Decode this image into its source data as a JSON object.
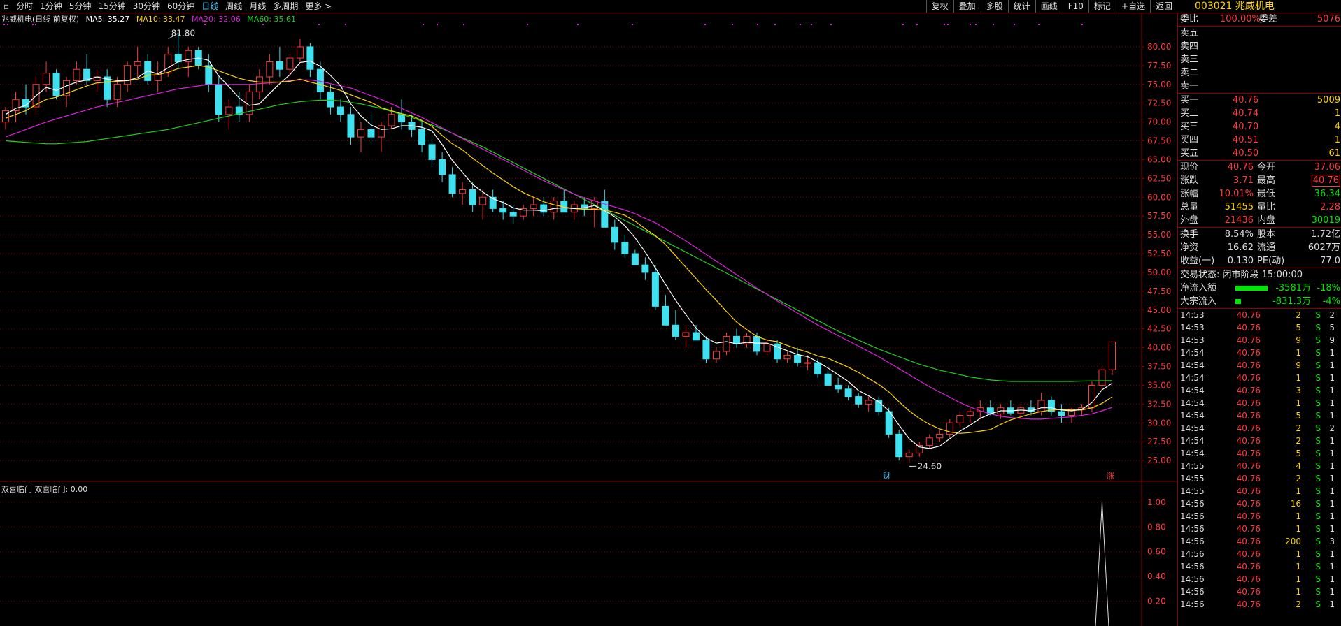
{
  "toolbar": {
    "tabs": [
      "分时",
      "1分钟",
      "5分钟",
      "15分钟",
      "30分钟",
      "60分钟",
      "日线",
      "周线",
      "月线",
      "多周期",
      "更多 >"
    ],
    "active_tab": "日线",
    "right_buttons": [
      "复权",
      "叠加",
      "多股",
      "统计",
      "画线",
      "F10",
      "标记",
      "+自选",
      "返回"
    ]
  },
  "stock": {
    "code": "003021",
    "name": "兆威机电"
  },
  "legend": {
    "title": "兆威机电(日线 前复权)",
    "ma5": "MA5: 35.27",
    "ma10": "MA10: 33.47",
    "ma20": "MA20: 32.06",
    "ma60": "MA60: 35.61"
  },
  "colors": {
    "up": "#ff3b3b",
    "down": "#3fe0f0",
    "ma5": "#ffffff",
    "ma10": "#ffd400",
    "ma20": "#e020e0",
    "ma60": "#20d020",
    "grid": "#8b0000"
  },
  "markers": {
    "high": "81.80",
    "low": "24.60",
    "cai": "财",
    "zhang": "涨"
  },
  "sub_legend": "双喜临门 双喜临门: 0.00",
  "chart_data": {
    "type": "candlestick",
    "y_ticks": [
      "80.00",
      "77.50",
      "75.00",
      "72.50",
      "70.00",
      "67.50",
      "65.00",
      "62.50",
      "60.00",
      "57.50",
      "55.00",
      "52.50",
      "50.00",
      "47.50",
      "45.00",
      "42.50",
      "40.00",
      "37.50",
      "35.00",
      "32.50",
      "30.00",
      "27.50",
      "25.00"
    ],
    "ylim": [
      22.5,
      82.5
    ],
    "candles": [
      [
        70,
        72,
        69,
        71.5
      ],
      [
        71.5,
        74,
        70,
        73
      ],
      [
        73,
        75,
        71,
        72
      ],
      [
        72,
        76,
        71,
        75
      ],
      [
        75,
        78,
        74,
        76.5
      ],
      [
        76.5,
        77,
        73,
        73.5
      ],
      [
        73.5,
        76,
        72,
        75.5
      ],
      [
        75.5,
        78,
        75,
        77
      ],
      [
        77,
        79,
        75,
        75.5
      ],
      [
        75.5,
        77,
        74,
        76
      ],
      [
        76,
        77,
        72,
        73
      ],
      [
        73,
        76,
        72,
        75
      ],
      [
        75,
        78,
        74,
        77.5
      ],
      [
        77.5,
        80,
        76,
        78
      ],
      [
        78,
        79,
        75,
        75.5
      ],
      [
        75.5,
        78,
        74,
        76.5
      ],
      [
        76.5,
        80,
        76,
        79
      ],
      [
        79,
        81.8,
        77,
        78
      ],
      [
        78,
        80,
        76,
        79.5
      ],
      [
        79.5,
        80,
        77,
        77.5
      ],
      [
        77.5,
        79,
        74,
        75
      ],
      [
        75,
        76,
        70,
        71
      ],
      [
        71,
        73,
        69,
        72
      ],
      [
        72,
        74,
        70,
        71
      ],
      [
        71,
        75,
        70,
        74
      ],
      [
        74,
        77,
        73,
        76
      ],
      [
        76,
        79,
        75,
        78
      ],
      [
        78,
        80,
        76,
        77
      ],
      [
        77,
        79,
        76,
        78.5
      ],
      [
        78.5,
        81,
        78,
        80
      ],
      [
        80,
        80.5,
        76,
        77
      ],
      [
        77,
        78,
        73,
        74
      ],
      [
        74,
        75,
        71,
        72
      ],
      [
        72,
        73,
        70,
        71
      ],
      [
        71,
        72,
        67,
        68
      ],
      [
        68,
        70,
        66,
        69
      ],
      [
        69,
        71,
        67,
        68
      ],
      [
        68,
        70,
        66,
        69.5
      ],
      [
        69.5,
        72,
        69,
        71
      ],
      [
        71,
        73,
        69,
        70
      ],
      [
        70,
        71,
        68,
        69
      ],
      [
        69,
        70,
        66,
        67
      ],
      [
        67,
        68,
        64,
        65
      ],
      [
        65,
        66,
        62,
        63
      ],
      [
        63,
        64,
        60,
        60.5
      ],
      [
        60.5,
        62,
        59,
        61
      ],
      [
        61,
        62,
        58,
        59
      ],
      [
        59,
        61,
        57,
        60
      ],
      [
        60,
        61,
        58,
        58.5
      ],
      [
        58.5,
        59.5,
        57,
        58
      ],
      [
        58,
        59,
        56.5,
        57.5
      ],
      [
        57.5,
        59,
        57,
        58.5
      ],
      [
        58.5,
        60,
        57.5,
        59
      ],
      [
        59,
        60,
        57.5,
        58
      ],
      [
        58,
        60,
        57,
        59.5
      ],
      [
        59.5,
        61,
        58,
        58
      ],
      [
        58,
        59.5,
        57,
        59
      ],
      [
        59,
        60,
        57.5,
        58.5
      ],
      [
        58.5,
        60,
        56,
        59.5
      ],
      [
        59.5,
        61,
        57,
        56
      ],
      [
        56,
        57,
        53,
        54
      ],
      [
        54,
        55,
        52,
        52.5
      ],
      [
        52.5,
        53,
        51,
        51
      ],
      [
        51,
        52,
        49,
        50
      ],
      [
        50,
        51,
        45,
        45.5
      ],
      [
        45.5,
        47,
        43,
        43
      ],
      [
        43,
        45,
        41,
        41.5
      ],
      [
        41.5,
        43,
        40,
        42
      ],
      [
        42,
        43,
        41,
        41
      ],
      [
        41,
        41.5,
        38,
        38.5
      ],
      [
        38.5,
        40,
        38,
        39.5
      ],
      [
        39.5,
        42,
        39,
        41.5
      ],
      [
        41.5,
        42.5,
        40,
        40.5
      ],
      [
        40.5,
        42,
        40,
        41.5
      ],
      [
        41.5,
        42,
        39,
        39.5
      ],
      [
        39.5,
        41,
        39,
        40.5
      ],
      [
        40.5,
        41,
        38,
        38.5
      ],
      [
        38.5,
        39.5,
        38,
        39
      ],
      [
        39,
        40,
        37.5,
        38
      ],
      [
        38,
        39,
        37,
        38
      ],
      [
        38,
        38.5,
        36,
        36.5
      ],
      [
        36.5,
        37,
        35,
        35
      ],
      [
        35,
        36,
        34,
        34.5
      ],
      [
        34.5,
        35,
        33,
        33.5
      ],
      [
        33.5,
        34,
        32,
        32.5
      ],
      [
        32.5,
        33.5,
        31.5,
        33
      ],
      [
        33,
        33.5,
        31,
        31.5
      ],
      [
        31.5,
        32,
        28,
        28.5
      ],
      [
        28.5,
        29,
        25,
        25.5
      ],
      [
        25.5,
        26.5,
        24.6,
        26
      ],
      [
        26,
        27.5,
        25.5,
        27
      ],
      [
        27,
        28.5,
        26.5,
        28
      ],
      [
        28,
        29,
        27.5,
        28.5
      ],
      [
        28.5,
        30.5,
        28,
        30
      ],
      [
        30,
        31.5,
        29.5,
        31
      ],
      [
        31,
        32,
        30,
        31.5
      ],
      [
        31.5,
        33,
        30.5,
        32
      ],
      [
        32,
        33,
        31,
        31.2
      ],
      [
        31.2,
        32.5,
        30.5,
        32
      ],
      [
        32,
        33,
        31,
        31.3
      ],
      [
        31.3,
        32.5,
        30.5,
        32
      ],
      [
        32,
        33,
        31,
        31.5
      ],
      [
        31.5,
        34,
        31,
        33
      ],
      [
        33,
        33.5,
        31,
        31.5
      ],
      [
        31.5,
        32.5,
        30,
        31
      ],
      [
        31,
        32,
        30,
        31.8
      ],
      [
        31.8,
        32.5,
        31,
        32
      ],
      [
        32,
        35.5,
        31.5,
        35
      ],
      [
        35,
        37.5,
        34.5,
        37.06
      ],
      [
        37.06,
        40.76,
        36.34,
        40.76
      ]
    ],
    "ma5": [
      71,
      71.8,
      72.2,
      73.5,
      74.6,
      74.2,
      74.8,
      75.3,
      75.6,
      76,
      75.7,
      75.5,
      75.5,
      75.9,
      76.8,
      76.4,
      77.2,
      78,
      78.3,
      78.5,
      78.2,
      76.1,
      74.7,
      73.2,
      72.2,
      72.4,
      73.8,
      75.1,
      76.3,
      77.9,
      78.1,
      77.4,
      76.2,
      74.8,
      72.4,
      70.8,
      69.6,
      69,
      69.1,
      69.5,
      69.5,
      69.3,
      68.8,
      67,
      64.9,
      63.3,
      61.7,
      60.7,
      59.8,
      59.3,
      58.6,
      58.3,
      58.3,
      58.2,
      58.5,
      58.6,
      58.5,
      58.6,
      58.9,
      58.2,
      57.4,
      56.2,
      54.6,
      52.7,
      50.6,
      48.4,
      46.3,
      44.4,
      42.6,
      41.3,
      40.6,
      40.8,
      40.5,
      40.7,
      40.6,
      40.6,
      40.1,
      39.6,
      39.1,
      38.8,
      38.1,
      37.3,
      36.4,
      35.5,
      34.3,
      33.6,
      32.8,
      31.6,
      29.7,
      27.9,
      26.8,
      26.6,
      26.9,
      27.9,
      28.9,
      29.7,
      30.6,
      31.2,
      31.6,
      31.6,
      31.7,
      31.6,
      32,
      32,
      31.7,
      31.6,
      31.8,
      32.7,
      34.4,
      35.27
    ],
    "ma10": [
      70.5,
      71,
      71.5,
      72.3,
      73,
      73.3,
      73.8,
      74.3,
      74.8,
      75.2,
      75.3,
      75.4,
      75.5,
      75.7,
      76.2,
      76.3,
      76.6,
      77.1,
      77.3,
      77.5,
      77.3,
      76.8,
      76.3,
      75.8,
      75.5,
      75.3,
      75.3,
      75.3,
      75.4,
      75.7,
      75.3,
      75,
      74.6,
      74.2,
      73.6,
      73.1,
      72.6,
      71.9,
      71.5,
      71.1,
      70.8,
      70.2,
      69.4,
      68.2,
      67.1,
      66.3,
      65.2,
      64.2,
      63.2,
      62.3,
      61.4,
      60.6,
      60,
      59.4,
      59,
      58.7,
      58.5,
      58.4,
      58.4,
      58.3,
      58,
      57.6,
      56.8,
      55.8,
      54.9,
      53.7,
      52.2,
      50.7,
      49.2,
      47.7,
      46.3,
      44.8,
      43.4,
      42.4,
      41.5,
      41,
      40.8,
      40.3,
      39.8,
      39.4,
      38.9,
      38.6,
      38,
      37.4,
      36.7,
      35.9,
      35.1,
      34.1,
      32.8,
      31.6,
      30.6,
      29.8,
      29.2,
      28.8,
      28.6,
      28.7,
      28.9,
      29.1,
      29.8,
      30.4,
      30.8,
      31.2,
      31.5,
      31.7,
      31.8,
      31.7,
      31.7,
      32,
      32.6,
      33.47
    ],
    "ma20": [
      68,
      68.5,
      69,
      69.5,
      70,
      70.4,
      70.8,
      71.2,
      71.6,
      72,
      72.3,
      72.6,
      72.9,
      73.2,
      73.5,
      73.8,
      74.1,
      74.4,
      74.6,
      74.8,
      75,
      75,
      75,
      75,
      75,
      75.1,
      75.2,
      75.3,
      75.5,
      75.6,
      75.6,
      75.4,
      75.1,
      74.8,
      74.5,
      74,
      73.5,
      73,
      72.4,
      71.8,
      71.2,
      70.6,
      69.9,
      69.2,
      68.5,
      67.8,
      67.1,
      66.4,
      65.7,
      65,
      64.3,
      63.6,
      62.9,
      62.2,
      61.6,
      61,
      60.4,
      59.9,
      59.5,
      59.1,
      58.7,
      58.3,
      57.8,
      57.2,
      56.6,
      55.8,
      55,
      54.2,
      53.3,
      52.4,
      51.5,
      50.6,
      49.7,
      48.8,
      47.9,
      47.1,
      46.2,
      45.4,
      44.6,
      43.8,
      43,
      42.3,
      41.6,
      40.9,
      40.2,
      39.5,
      38.8,
      38,
      37.2,
      36.4,
      35.6,
      34.8,
      34.1,
      33.4,
      32.7,
      32.1,
      31.6,
      31.2,
      30.9,
      30.7,
      30.6,
      30.5,
      30.5,
      30.6,
      30.7,
      30.8,
      31,
      31.2,
      31.6,
      32.06
    ],
    "ma60": [
      67.5,
      67.4,
      67.3,
      67.2,
      67.1,
      67.1,
      67.2,
      67.3,
      67.4,
      67.6,
      67.8,
      68,
      68.2,
      68.4,
      68.6,
      68.8,
      69,
      69.3,
      69.6,
      69.9,
      70.2,
      70.5,
      70.8,
      71.1,
      71.4,
      71.7,
      72,
      72.3,
      72.5,
      72.7,
      72.8,
      72.9,
      72.9,
      72.8,
      72.6,
      72.4,
      72.1,
      71.8,
      71.4,
      71,
      70.6,
      70.1,
      69.6,
      69.1,
      68.5,
      67.9,
      67.3,
      66.7,
      66,
      65.3,
      64.6,
      63.9,
      63.2,
      62.5,
      61.8,
      61.1,
      60.4,
      59.7,
      59,
      58.3,
      57.6,
      56.9,
      56.2,
      55.5,
      54.8,
      54.1,
      53.4,
      52.7,
      52,
      51.3,
      50.6,
      49.9,
      49.2,
      48.5,
      47.8,
      47.1,
      46.4,
      45.7,
      45,
      44.3,
      43.6,
      42.9,
      42.2,
      41.6,
      41,
      40.4,
      39.8,
      39.3,
      38.8,
      38.3,
      37.8,
      37.4,
      37,
      36.7,
      36.4,
      36.1,
      35.9,
      35.7,
      35.6,
      35.5,
      35.5,
      35.5,
      35.5,
      35.5,
      35.5,
      35.5,
      35.55,
      35.58,
      35.6,
      35.61
    ],
    "sub_y_ticks": [
      "1.00",
      "0.80",
      "0.60",
      "0.40",
      "0.20"
    ],
    "sub_ylim": [
      0,
      1.05
    ]
  },
  "panel": {
    "weibi": {
      "label": "委比",
      "value": "100.00%",
      "label2": "委差",
      "value2": "5076"
    },
    "sell": [
      {
        "label": "卖五"
      },
      {
        "label": "卖四"
      },
      {
        "label": "卖三"
      },
      {
        "label": "卖二"
      },
      {
        "label": "卖一"
      }
    ],
    "buy": [
      {
        "label": "买一",
        "price": "40.76",
        "vol": "5009"
      },
      {
        "label": "买二",
        "price": "40.74",
        "vol": "1"
      },
      {
        "label": "买三",
        "price": "40.70",
        "vol": "4"
      },
      {
        "label": "买四",
        "price": "40.51",
        "vol": "1"
      },
      {
        "label": "买五",
        "price": "40.50",
        "vol": "61"
      }
    ],
    "quote": [
      {
        "l1": "现价",
        "v1": "40.76",
        "l2": "今开",
        "v2": "37.06"
      },
      {
        "l1": "涨跌",
        "v1": "3.71",
        "l2": "最高",
        "v2": "40.76"
      },
      {
        "l1": "涨幅",
        "v1": "10.01%",
        "l2": "最低",
        "v2": "36.34"
      },
      {
        "l1": "总量",
        "v1": "51455",
        "l2": "量比",
        "v2": "2.28"
      },
      {
        "l1": "外盘",
        "v1": "21436",
        "l2": "内盘",
        "v2": "30019"
      }
    ],
    "fund": [
      {
        "l1": "换手",
        "v1": "8.54%",
        "l2": "股本",
        "v2": "1.72亿"
      },
      {
        "l1": "净资",
        "v1": "16.62",
        "l2": "流通",
        "v2": "6027万"
      },
      {
        "l1": "收益(一)",
        "v1": "0.130",
        "l2": "PE(动)",
        "v2": "77.0"
      }
    ],
    "status": "交易状态: 闭市阶段 15:00:00",
    "flow": [
      {
        "label": "净流入额",
        "value": "-3581万",
        "pct": "-18%"
      },
      {
        "label": "大宗流入",
        "value": "-831.3万",
        "pct": "-4%"
      }
    ],
    "ticks": [
      [
        "14:53",
        "40.76",
        "2",
        "S",
        "2"
      ],
      [
        "14:53",
        "40.76",
        "5",
        "S",
        "5"
      ],
      [
        "14:53",
        "40.76",
        "9",
        "S",
        "9"
      ],
      [
        "14:54",
        "40.76",
        "1",
        "S",
        "1"
      ],
      [
        "14:54",
        "40.76",
        "9",
        "S",
        "1"
      ],
      [
        "14:54",
        "40.76",
        "1",
        "S",
        "1"
      ],
      [
        "14:54",
        "40.76",
        "3",
        "S",
        "1"
      ],
      [
        "14:54",
        "40.76",
        "1",
        "S",
        "1"
      ],
      [
        "14:54",
        "40.76",
        "5",
        "S",
        "1"
      ],
      [
        "14:54",
        "40.76",
        "2",
        "S",
        "2"
      ],
      [
        "14:54",
        "40.76",
        "2",
        "S",
        "1"
      ],
      [
        "14:54",
        "40.76",
        "5",
        "S",
        "1"
      ],
      [
        "14:55",
        "40.76",
        "4",
        "S",
        "1"
      ],
      [
        "14:55",
        "40.76",
        "2",
        "S",
        "1"
      ],
      [
        "14:55",
        "40.76",
        "1",
        "S",
        "1"
      ],
      [
        "14:56",
        "40.76",
        "16",
        "S",
        "1"
      ],
      [
        "14:56",
        "40.76",
        "1",
        "S",
        "1"
      ],
      [
        "14:56",
        "40.76",
        "1",
        "S",
        "1"
      ],
      [
        "14:56",
        "40.76",
        "200",
        "S",
        "3"
      ],
      [
        "14:56",
        "40.76",
        "1",
        "S",
        "1"
      ],
      [
        "14:56",
        "40.76",
        "1",
        "S",
        "1"
      ],
      [
        "14:56",
        "40.76",
        "1",
        "S",
        "1"
      ],
      [
        "14:56",
        "40.76",
        "1",
        "S",
        "1"
      ],
      [
        "14:56",
        "40.76",
        "2",
        "S",
        "1"
      ]
    ]
  }
}
